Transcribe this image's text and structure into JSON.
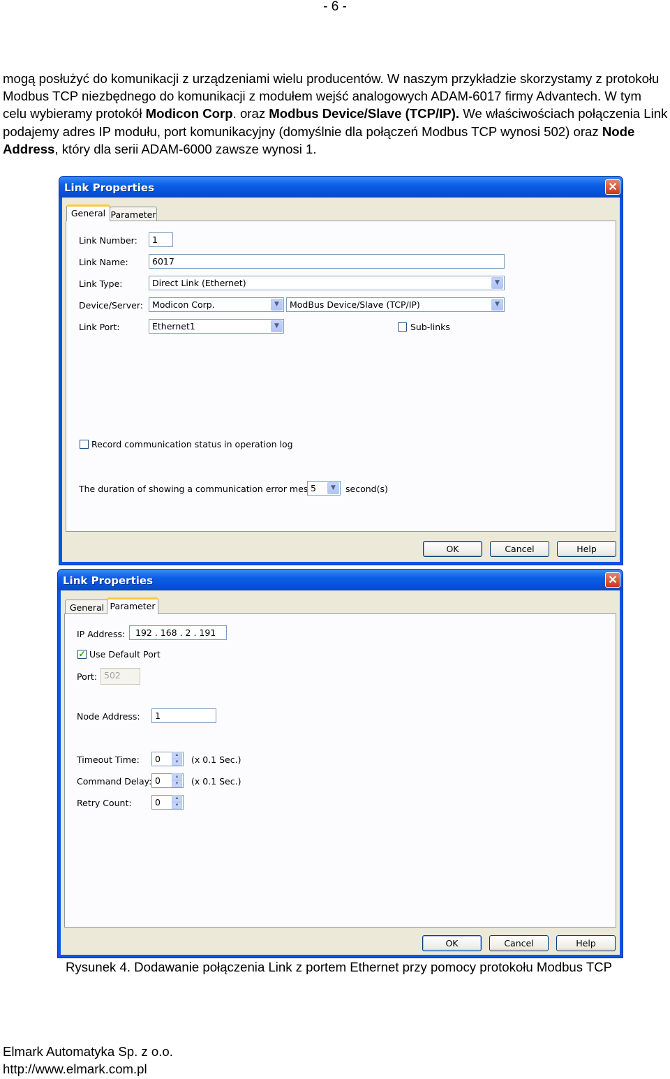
{
  "page_number": "- 6 -",
  "paragraph": {
    "t1": "mogą posłużyć do komunikacji z urządzeniami wielu producentów. W naszym przykładzie skorzystamy z protokołu Modbus TCP niezbędnego do komunikacji z modułem wejść analogowych ADAM-6017 firmy Advantech. W tym celu wybieramy protokół ",
    "b1": "Modicon Corp",
    "t2": ". oraz ",
    "b2": "Modbus Device/Slave (TCP/IP).",
    "t3": " We właściwościach połączenia Link podajemy adres IP modułu, port komunikacyjny (domyślnie dla połączeń Modbus TCP wynosi 502) oraz ",
    "b3": "Node Address",
    "t4": ", który dla serii ADAM-6000 zawsze wynosi 1."
  },
  "dialog1": {
    "title": "Link Properties",
    "close": "✕",
    "tabs": [
      "General",
      "Parameter"
    ],
    "link_number_label": "Link Number:",
    "link_number": "1",
    "link_name_label": "Link Name:",
    "link_name": "6017",
    "link_type_label": "Link Type:",
    "link_type": "Direct Link (Ethernet)",
    "device_label": "Device/Server:",
    "device_maker": "Modicon Corp.",
    "device_model": "ModBus Device/Slave (TCP/IP)",
    "link_port_label": "Link Port:",
    "link_port": "Ethernet1",
    "sublinks_label": "Sub-links",
    "record_label": "Record communication status in operation log",
    "duration_label": "The duration of showing a communication error message:",
    "duration_value": "5",
    "duration_unit": "second(s)",
    "ok": "OK",
    "cancel": "Cancel",
    "help": "Help"
  },
  "dialog2": {
    "title": "Link Properties",
    "close": "✕",
    "tabs": [
      "General",
      "Parameter"
    ],
    "ip_label": "IP Address:",
    "ip_value": "192 . 168 .   2   . 191",
    "use_default_port_label": "Use Default Port",
    "port_label": "Port:",
    "port_value": "502",
    "node_address_label": "Node Address:",
    "node_address": "1",
    "timeout_label": "Timeout Time:",
    "timeout_value": "0",
    "timeout_unit": "(x 0.1 Sec.)",
    "cmd_delay_label": "Command Delay:",
    "cmd_delay_value": "0",
    "cmd_delay_unit": "(x 0.1 Sec.)",
    "retry_label": "Retry Count:",
    "retry_value": "0",
    "ok": "OK",
    "cancel": "Cancel",
    "help": "Help"
  },
  "caption": "Rysunek 4. Dodawanie połączenia Link z portem Ethernet przy pomocy protokołu Modbus TCP",
  "footer": {
    "company": "Elmark Automatyka Sp. z o.o.",
    "url": "http://www.elmark.com.pl"
  }
}
